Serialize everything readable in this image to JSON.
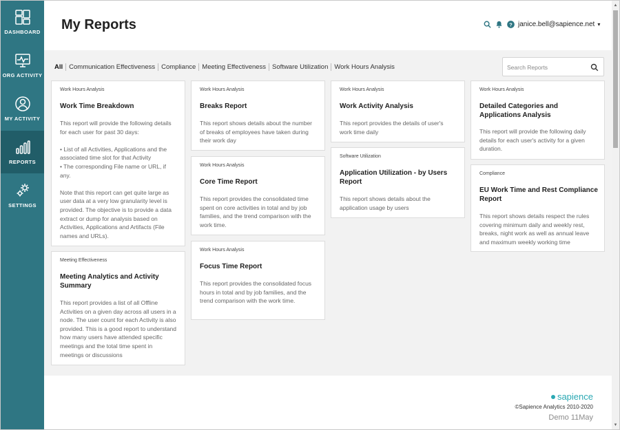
{
  "sidebar": {
    "items": [
      {
        "label": "DASHBOARD",
        "icon": "dashboard-icon"
      },
      {
        "label": "ORG ACTIVITY",
        "icon": "org-activity-icon"
      },
      {
        "label": "MY ACTIVITY",
        "icon": "user-icon"
      },
      {
        "label": "REPORTS",
        "icon": "reports-icon",
        "active": true
      },
      {
        "label": "SETTINGS",
        "icon": "gear-icon"
      }
    ]
  },
  "header": {
    "title": "My Reports",
    "user_email": "janice.bell@sapience.net",
    "caret": "▾"
  },
  "filters": [
    "All",
    "Communication Effectiveness",
    "Compliance",
    "Meeting Effectiveness",
    "Software Utilization",
    "Work Hours Analysis"
  ],
  "search": {
    "placeholder": "Search Reports",
    "value": ""
  },
  "cards": [
    {
      "category": "Work Hours Analysis",
      "title": "Work Time Breakdown",
      "description": "This report will provide the following details for each user for past 30 days:\n\n• List of all Activities, Applications and the associated time slot for that Activity\n• The corresponding File name or URL, if any.\n\nNote that this report can get quite large as user data at a very low granularity level is provided. The objective is to provide a data extract or dump for analysis based on Activities, Applications and Artifacts (File names and URLs)."
    },
    {
      "category": "Meeting Effectiveness",
      "title": "Meeting Analytics and Activity Summary",
      "description": "This report provides a list of all Offline Activities on a given day across all users in a node. The user count for each Activity is also provided. This is a good report to understand how many users have attended specific meetings and the total time spent in meetings or discussions"
    },
    {
      "category": "Work Hours Analysis",
      "title": "Breaks Report",
      "description": "This report shows details about the number of breaks of employees have taken during their work day"
    },
    {
      "category": "Work Hours Analysis",
      "title": "Core Time Report",
      "description": "This report provides the consolidated time spent on core activities in total and by job families, and the trend comparison with the work time."
    },
    {
      "category": "Work Hours Analysis",
      "title": "Focus Time Report",
      "description": "This report provides the consolidated focus hours in total and by job families, and the trend comparison with the work time."
    },
    {
      "category": "Work Hours Analysis",
      "title": "Work Activity Analysis",
      "description": "This report provides the details of user's work time daily"
    },
    {
      "category": "Software Utilization",
      "title": "Application Utilization - by Users Report",
      "description": "This report shows details about the application usage by users"
    },
    {
      "category": "Work Hours Analysis",
      "title": "Detailed Categories and Applications Analysis",
      "description": "This report will provide the following daily details for each user's activity for a given duration."
    },
    {
      "category": "Compliance",
      "title": "EU Work Time and Rest Compliance Report",
      "description": "This report shows details respect the rules covering minimum daily and weekly rest, breaks, night work as well as annual leave and maximum weekly working time"
    }
  ],
  "footer": {
    "brand": "sapience",
    "copyright": "©Sapience Analytics 2010-2020",
    "demo": "Demo 11May"
  },
  "colors": {
    "sidebar": "#2f7683",
    "sidebar_active": "#215d68",
    "accent": "#2aa8b3",
    "content_bg": "#f2f2f2"
  }
}
